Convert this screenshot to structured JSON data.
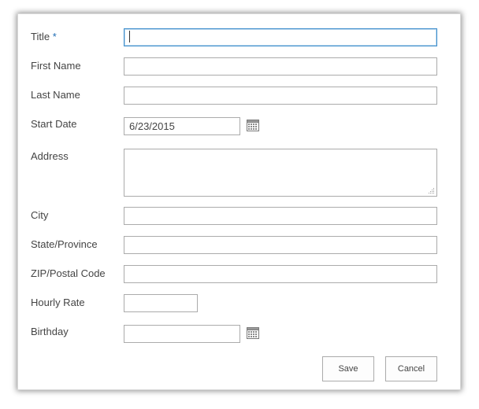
{
  "form": {
    "fields": [
      {
        "label": "Title",
        "required_mark": "*",
        "value": ""
      },
      {
        "label": "First Name",
        "value": ""
      },
      {
        "label": "Last Name",
        "value": ""
      },
      {
        "label": "Start Date",
        "value": "6/23/2015"
      },
      {
        "label": "Address",
        "value": ""
      },
      {
        "label": "City",
        "value": ""
      },
      {
        "label": "State/Province",
        "value": ""
      },
      {
        "label": "ZIP/Postal Code",
        "value": ""
      },
      {
        "label": "Hourly Rate",
        "value": ""
      },
      {
        "label": "Birthday",
        "value": ""
      }
    ],
    "save_label": "Save",
    "cancel_label": "Cancel"
  },
  "colors": {
    "required": "#1f6db5",
    "focus_border": "#3e8ecc",
    "field_border": "#ababab",
    "label_text": "#444444"
  },
  "icons": [
    "calendar-icon",
    "resize-grip-icon"
  ]
}
